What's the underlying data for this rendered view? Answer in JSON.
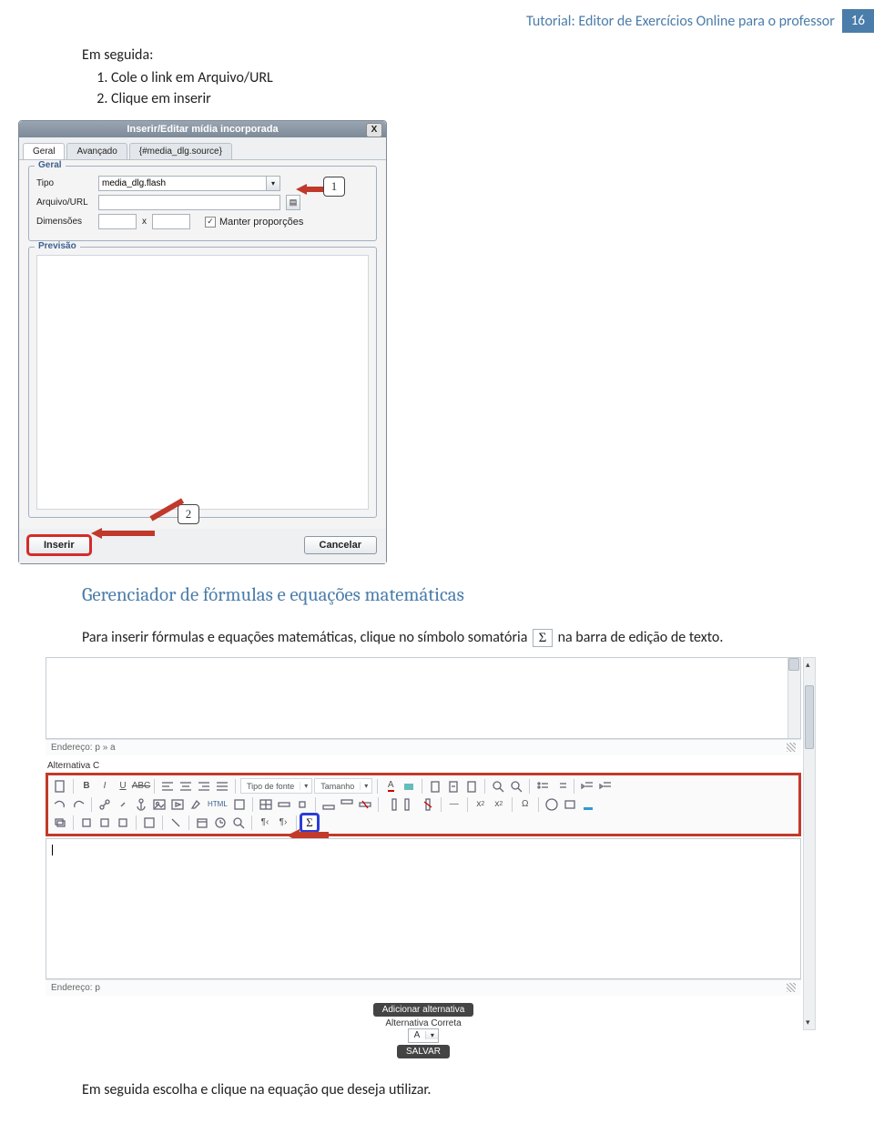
{
  "header": {
    "title": "Tutorial: Editor de Exercícios Online para o professor",
    "page_number": "16"
  },
  "intro": {
    "lead": "Em seguida:",
    "steps": [
      "Cole o link em Arquivo/URL",
      "Clique em inserir"
    ]
  },
  "dialog": {
    "title": "Inserir/Editar mídia incorporada",
    "close_label": "X",
    "tabs": [
      "Geral",
      "Avançado",
      "{#media_dlg.source}"
    ],
    "fieldset_geral": "Geral",
    "labels": {
      "tipo": "Tipo",
      "arquivo_url": "Arquivo/URL",
      "dimensoes": "Dimensões",
      "manter": "Manter proporções"
    },
    "tipo_value": "media_dlg.flash",
    "arquivo_url_value": "",
    "dim_w": "",
    "dim_h": "",
    "manter_checked": "✓",
    "fieldset_previsao": "Previsão",
    "btn_insert": "Inserir",
    "btn_cancel": "Cancelar",
    "callout1": "1",
    "callout2": "2"
  },
  "section": {
    "heading": "Gerenciador de fórmulas e equações matemáticas",
    "para_before": "Para inserir fórmulas e equações matemáticas, clique no símbolo somatória ",
    "sigma": "Σ",
    "para_after": " na barra de edição de texto.",
    "closing": "Em seguida escolha e clique na equação que deseja utilizar."
  },
  "editor": {
    "path1": "Endereço: p » a",
    "section_label": "Alternativa C",
    "font_dd": "Tipo de fonte",
    "size_dd": "Tamanho",
    "html_label": "HTML",
    "row3_sigma": "Σ",
    "path2": "Endereço: p",
    "add_alt": "Adicionar alternativa",
    "alt_correct_label": "Alternativa Correta",
    "alt_correct_value": "A",
    "save_btn": "SALVAR"
  }
}
